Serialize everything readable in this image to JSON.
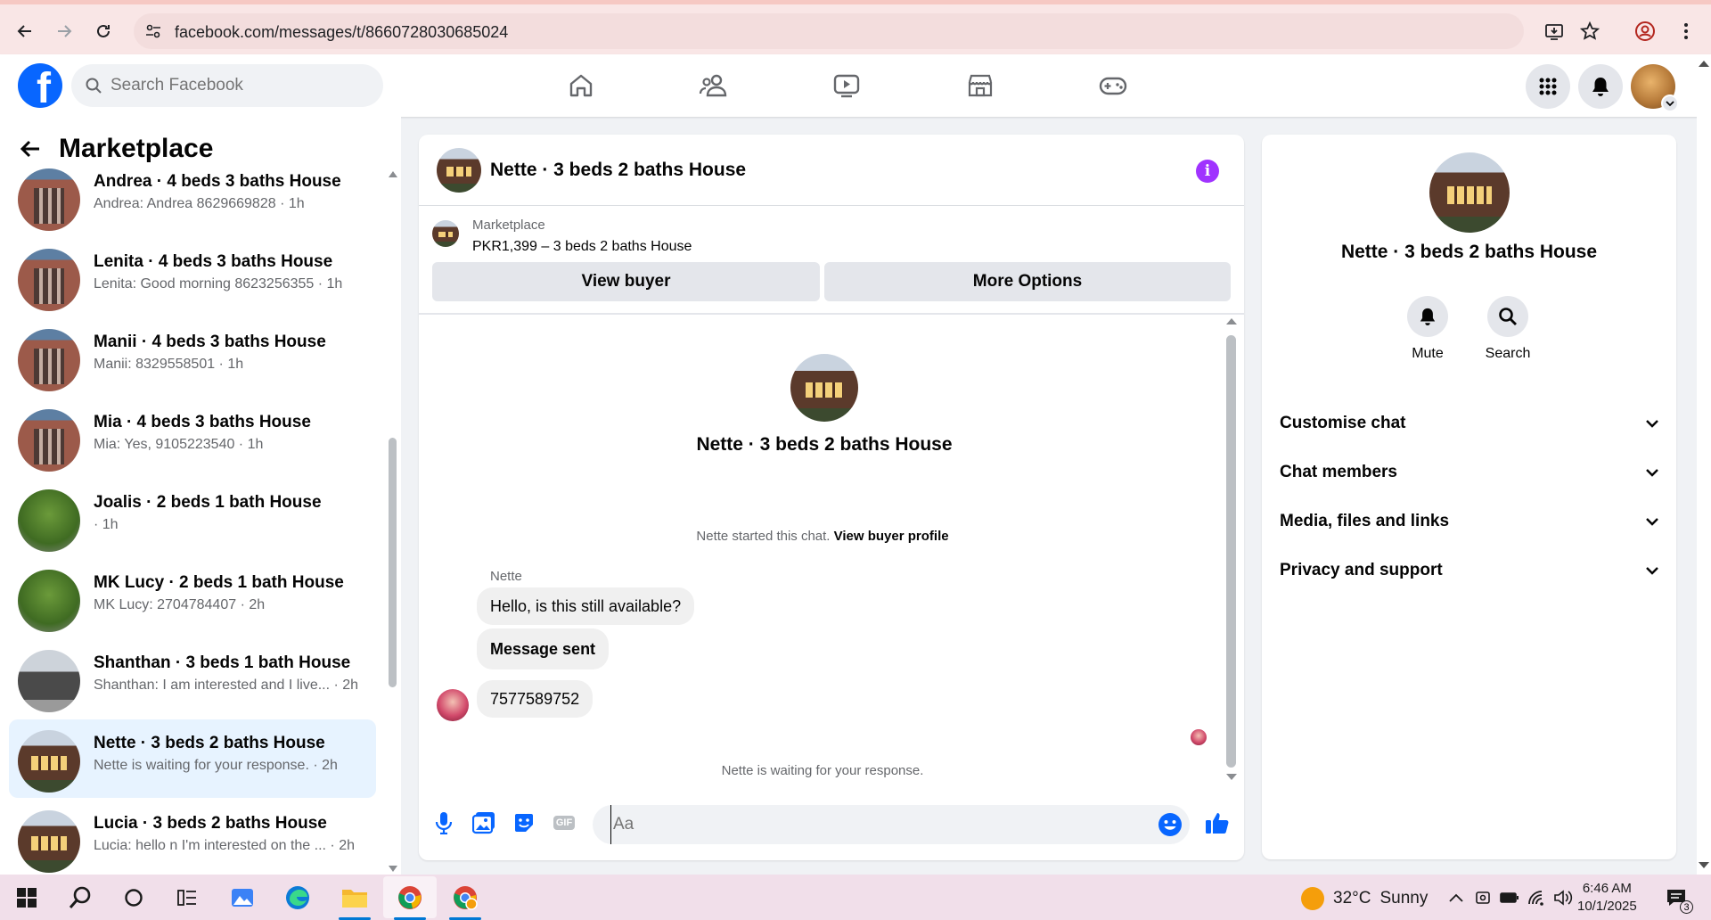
{
  "browser": {
    "url": "facebook.com/messages/t/8660728030685024"
  },
  "facebook": {
    "search_placeholder": "Search Facebook",
    "nav": [
      "home-icon",
      "friends-icon",
      "video-icon",
      "marketplace-icon",
      "gaming-icon"
    ]
  },
  "sidebar": {
    "title": "Marketplace",
    "conversations": [
      {
        "name": "Andrea · 4 beds 3 baths House",
        "preview": "Andrea: Andrea 8629669828 · 1h"
      },
      {
        "name": "Lenita · 4 beds 3 baths House",
        "preview": "Lenita: Good morning 8623256355 · 1h"
      },
      {
        "name": "Manii · 4 beds 3 baths House",
        "preview": "Manii: 8329558501 · 1h"
      },
      {
        "name": "Mia · 4 beds 3 baths House",
        "preview": "Mia: Yes, 9105223540 · 1h"
      },
      {
        "name": "Joalis · 2 beds 1 bath House",
        "preview": " · 1h"
      },
      {
        "name": "MK Lucy · 2 beds 1 bath House",
        "preview": "MK Lucy: 2704784407 · 2h"
      },
      {
        "name": "Shanthan · 3 beds 1 bath House",
        "preview": "Shanthan: I am interested and I live... · 2h"
      },
      {
        "name": "Nette · 3 beds 2 baths House",
        "preview": "Nette is waiting for your response. · 2h"
      },
      {
        "name": "Lucia · 3 beds 2 baths House",
        "preview": "Lucia: hello n I'm interested on the ... · 2h"
      }
    ]
  },
  "chat": {
    "title": "Nette · 3 beds 2 baths House",
    "marketplace_label": "Marketplace",
    "listing": "PKR1,399 – 3 beds 2 baths House",
    "view_buyer": "View buyer",
    "more_options": "More Options",
    "intro_name": "Nette · 3 beds 2 baths House",
    "started_text": "Nette started this chat.",
    "view_profile": "View buyer profile",
    "sender": "Nette",
    "messages": [
      "Hello, is this still available?",
      "Message sent",
      "7577589752"
    ],
    "waiting": "Nette is waiting for your response.",
    "composer_placeholder": "Aa",
    "gif_label": "GIF"
  },
  "details": {
    "name": "Nette · 3 beds 2 baths House",
    "mute": "Mute",
    "search": "Search",
    "sections": [
      "Customise chat",
      "Chat members",
      "Media, files and links",
      "Privacy and support"
    ]
  },
  "taskbar": {
    "temperature": "32°C",
    "weather": "Sunny",
    "time": "6:46 AM",
    "date": "10/1/2025",
    "notifications": "3"
  }
}
